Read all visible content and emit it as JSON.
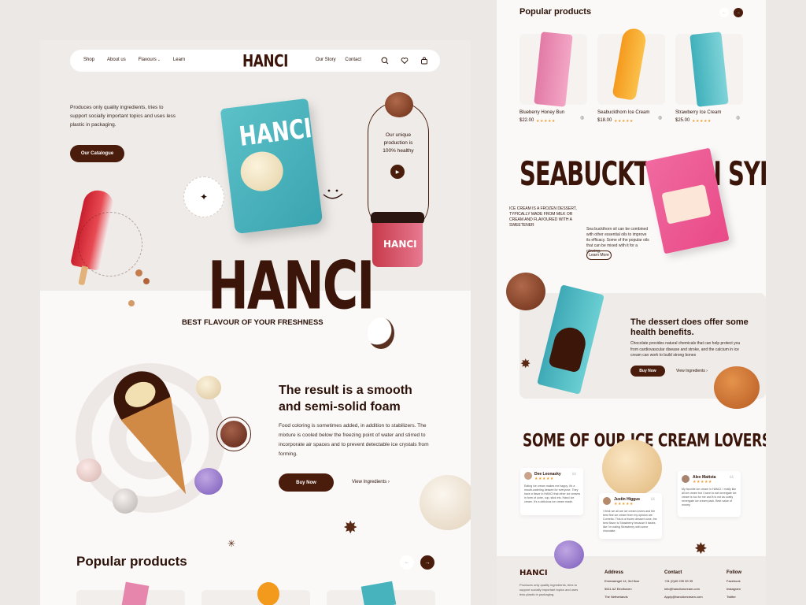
{
  "left": {
    "nav": {
      "items_left": [
        "Shop",
        "About us",
        "Flavours",
        "Learn"
      ],
      "logo": "HANCI",
      "items_right": [
        "Our Story",
        "Contact"
      ]
    },
    "hero": {
      "intro": "Produces only quality ingredients, tries to support socially important topics and uses less plastic in packaging.",
      "catalogue_btn": "Our Catalogue",
      "badge_ring": "NEW BEST SELLING PRODUCT",
      "healthy_text": "Our unique production is 100% healthy",
      "popsicle_ring": "MADE FROM NATURAL FRUIT",
      "title": "HANCI",
      "subtitle": "BEST FLAVOUR OF YOUR FRESHNESS",
      "pack_brand": "HANCI",
      "jar_brand": "HANCI"
    },
    "feature": {
      "heading": "The result is a smooth and semi-solid foam",
      "body": "Food coloring is sometimes added, in addition to stabilizers. The mixture is cooled below the freezing point of water and stirred to incorporate air spaces and to prevent detectable ice crystals from forming.",
      "buy_btn": "Buy Now",
      "ingredients_link": "View Ingredients"
    },
    "popular_title": "Popular products"
  },
  "right": {
    "popular_title": "Popular products",
    "products": [
      {
        "name": "Blueberry Honey Bun",
        "price": "$22.00"
      },
      {
        "name": "Seabuckthorn Ice Cream",
        "price": "$18.00"
      },
      {
        "name": "Strawberry Ice Cream",
        "price": "$25.00"
      }
    ],
    "big_title": "SEABUCKTHORN SYRUP",
    "desc_caps": "ICE CREAM IS A FROZEN DESSERT, TYPICALLY MADE FROM MILK OR CREAM AND FLAVOURED WITH A SWEETENER",
    "desc_small": "Sea buckthorn oil can be combined with other essential oils to improve its efficacy. Some of the popular oils that can be mixed with it for a glowing.",
    "learn_btn": "Learn More",
    "health": {
      "heading": "The dessert does offer some health benefits.",
      "body": "Chocolate provides natural chemicals that can help protect you from cardiovascular disease and stroke, and the calcium in ice cream can work to build strong bones",
      "buy_btn": "Buy Now",
      "ingredients_link": "View Ingredients"
    },
    "lovers_title": "SOME OF OUR ICE CREAM LOVERS",
    "reviews": [
      {
        "name": "Dee Leonasky",
        "text": "Eating ice cream makes me happy. It's a mouth-watering dessert for everyone. They have a flavor in HANCI that other ice creams in form of cone, cup, stick etc. Hanci ice cream. It's a delicious ice cream made."
      },
      {
        "name": "Justin Higgus",
        "text": "I think we all are ice cream lovers and the best fine ice cream from my opinion are Cornetto. This is a frozen dessert cone, the best flavor is Strawberry because it tastes like I'm eating Strawberry with some chocolate."
      },
      {
        "name": "Alex Mattsta",
        "text": "My favorite ice cream in HANCI. I really like all ice cream but I have to eat nevergate ice cream is too for me and it is not as costly nevergate ice cream pack. Best value of money."
      }
    ],
    "footer": {
      "logo": "HANCI",
      "about": "Produces only quality ingredients, tries to support socially important topics and uses less plastic in packaging.",
      "address_title": "Address",
      "address": [
        "Emmasingel 14, 3rd floor",
        "5611 AZ Eindhoven",
        "The Netherlands"
      ],
      "contact_title": "Contact",
      "contact": [
        "+31 (0)40 239 39 39",
        "info@hanciicecream.com",
        "Apply@hanciicecream.com"
      ],
      "follow_title": "Follow",
      "follow": [
        "Facebook",
        "Instagram",
        "Twitter"
      ]
    }
  }
}
